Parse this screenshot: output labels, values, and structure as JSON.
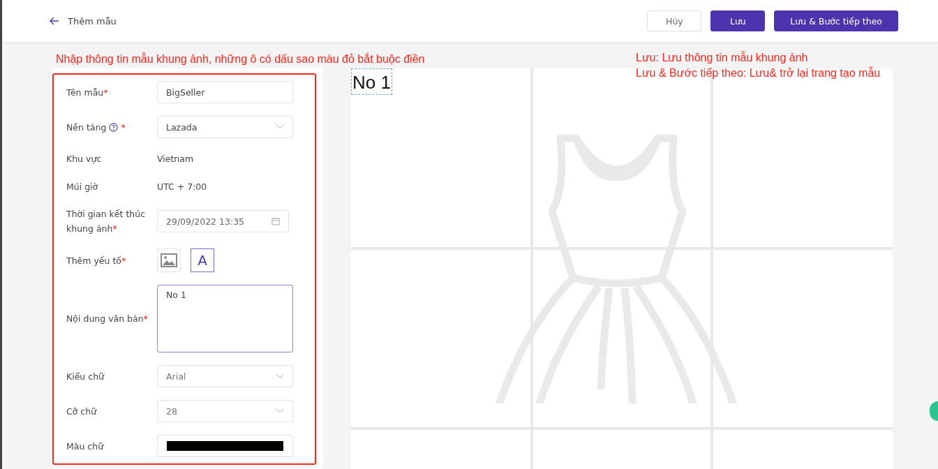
{
  "header": {
    "title": "Thêm mẫu",
    "buttons": [
      {
        "label": "Hủy",
        "kind": "default"
      },
      {
        "label": "Lưu",
        "kind": "primary"
      },
      {
        "label": "Lưu & Bước tiếp theo",
        "kind": "primary"
      }
    ]
  },
  "annotations": {
    "left": "Nhập thông tin mẫu khung ảnh, những ô có dấu sao màu đỏ bắt buộc điền",
    "right": [
      "Lưu: Lưu thông tin mẫu khung ảnh",
      "Lưu & Bước tiếp theo: Lưu& trở lại trang tạo mẫu"
    ]
  },
  "form": [
    {
      "kind": "input",
      "label": "Tên mẫu",
      "required_mark": "*",
      "value": "BigSeller"
    },
    {
      "kind": "select",
      "label": "Nền tảng",
      "required_mark": "*",
      "help": true,
      "value": "Lazada"
    },
    {
      "kind": "text",
      "label": "Khu vực",
      "value": "Vietnam"
    },
    {
      "kind": "text",
      "label": "Múi giờ",
      "value": "UTC + 7:00"
    },
    {
      "kind": "date",
      "label": "Thời gian kết thúc khung ảnh",
      "required_mark": "*",
      "value": "29/09/2022 13:35"
    },
    {
      "kind": "elements",
      "label": "Thêm yếu tố",
      "required_mark": "*",
      "options": [
        {
          "kind": "image",
          "selected": false
        },
        {
          "kind": "text",
          "glyph": "A",
          "selected": true
        }
      ]
    },
    {
      "kind": "textarea",
      "label": "Nội dung văn bản",
      "required_mark": "*",
      "value": "No 1"
    },
    {
      "kind": "select",
      "label": "Kiểu chữ",
      "value": "Arial"
    },
    {
      "kind": "select",
      "label": "Cỡ chữ",
      "value": "28"
    },
    {
      "kind": "color",
      "label": "Màu chữ",
      "color": "#000000"
    }
  ],
  "canvas": {
    "text": "No 1"
  }
}
